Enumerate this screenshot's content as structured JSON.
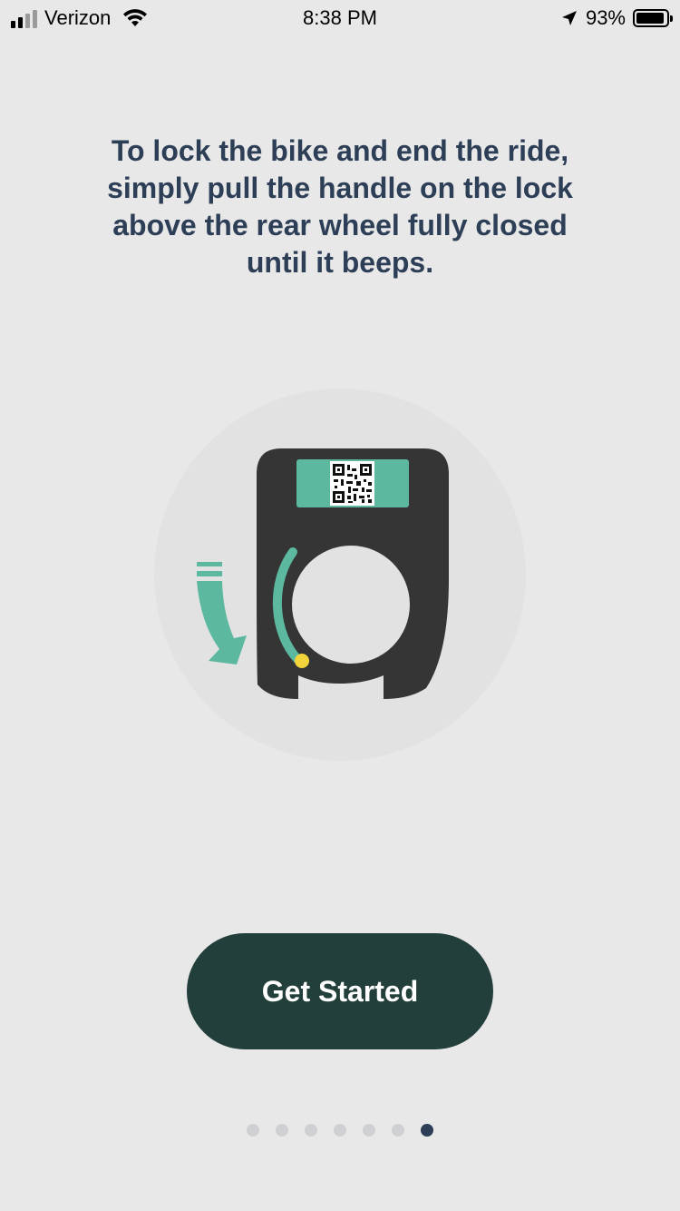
{
  "status_bar": {
    "carrier": "Verizon",
    "time": "8:38 PM",
    "battery_percent": "93%",
    "battery_level": 0.93,
    "signal_bars_active": 2,
    "signal_bars_total": 4,
    "icons": [
      "signal-icon",
      "wifi-icon",
      "location-arrow-icon",
      "battery-icon"
    ]
  },
  "main": {
    "instruction": "To lock the bike and end the ride, simply pull the handle on the lock above the rear wheel fully closed until it beeps.",
    "illustration": {
      "name": "bike-lock-illustration",
      "icons": [
        "qr-code-icon",
        "down-arrow-icon",
        "lock-handle-icon"
      ]
    },
    "button_label": "Get Started"
  },
  "pagination": {
    "total": 7,
    "current": 7
  },
  "colors": {
    "background": "#e9e8e8",
    "heading": "#2d3e57",
    "button": "#233f3b",
    "accent": "#5cb9a0",
    "lock_body": "#353535",
    "indicator": "#f3d53b"
  }
}
